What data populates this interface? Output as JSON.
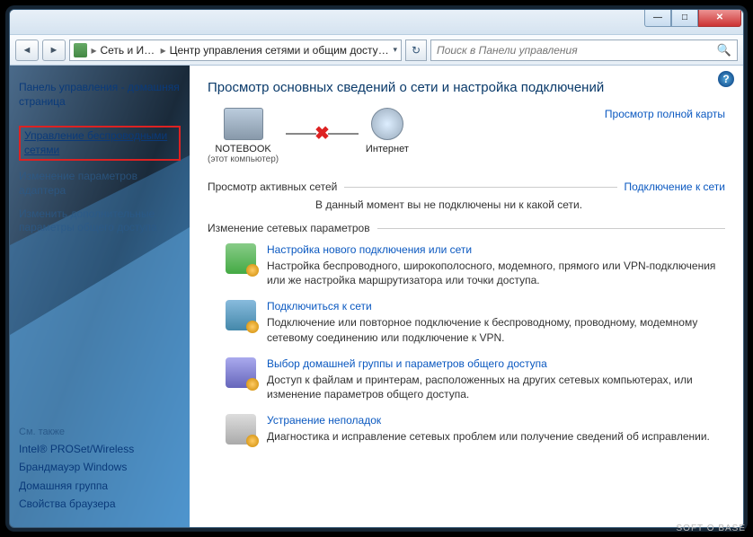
{
  "titlebar": {
    "min": "—",
    "max": "□",
    "close": "✕"
  },
  "nav": {
    "back": "◄",
    "forward": "►",
    "breadcrumb_root": "Сеть и Ин...",
    "breadcrumb_current": "Центр управления сетями и общим доступом",
    "refresh": "↻",
    "search_placeholder": "Поиск в Панели управления"
  },
  "sidebar": {
    "home": "Панель управления - домашняя страница",
    "items": [
      "Управление беспроводными сетями",
      "Изменение параметров адаптера",
      "Изменить дополнительные параметры общего доступа"
    ],
    "see_also_hdr": "См. также",
    "see_also": [
      "Intel® PROSet/Wireless",
      "Брандмауэр Windows",
      "Домашняя группа",
      "Свойства браузера"
    ]
  },
  "main": {
    "heading": "Просмотр основных сведений о сети и настройка подключений",
    "full_map": "Просмотр полной карты",
    "node1_label": "NOTEBOOK",
    "node1_sub": "(этот компьютер)",
    "node2_label": "Интернет",
    "active_hdr": "Просмотр активных сетей",
    "active_link": "Подключение к сети",
    "active_msg": "В данный момент вы не подключены ни к какой сети.",
    "change_hdr": "Изменение сетевых параметров",
    "tasks": [
      {
        "title": "Настройка нового подключения или сети",
        "desc": "Настройка беспроводного, широкополосного, модемного, прямого или VPN-подключения или же настройка маршрутизатора или точки доступа."
      },
      {
        "title": "Подключиться к сети",
        "desc": "Подключение или повторное подключение к беспроводному, проводному, модемному сетевому соединению или подключение к VPN."
      },
      {
        "title": "Выбор домашней группы и параметров общего доступа",
        "desc": "Доступ к файлам и принтерам, расположенных на других сетевых компьютерах, или изменение параметров общего доступа."
      },
      {
        "title": "Устранение неполадок",
        "desc": "Диагностика и исправление сетевых проблем или получение сведений об исправлении."
      }
    ]
  },
  "watermark": "SOFT O BASE"
}
